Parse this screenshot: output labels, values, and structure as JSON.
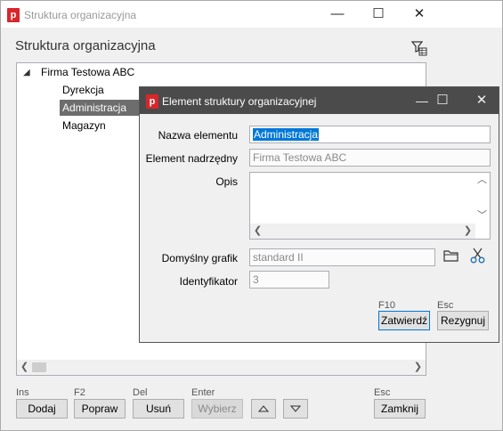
{
  "main_window": {
    "title": "Struktura organizacyjna",
    "app_icon_letter": "p",
    "controls": {
      "minimize": "—",
      "maximize": "☐",
      "close": "✕"
    },
    "heading": "Struktura organizacyjna",
    "tree": {
      "root": "Firma Testowa ABC",
      "children": [
        "Dyrekcja",
        "Administracja",
        "Magazyn"
      ],
      "selected_index": 1
    },
    "buttons": {
      "add": {
        "shortcut": "Ins",
        "label": "Dodaj"
      },
      "edit": {
        "shortcut": "F2",
        "label": "Popraw"
      },
      "delete": {
        "shortcut": "Del",
        "label": "Usuń"
      },
      "select": {
        "shortcut": "Enter",
        "label": "Wybierz"
      },
      "close": {
        "shortcut": "Esc",
        "label": "Zamknij"
      }
    }
  },
  "dialog": {
    "title": "Element struktury organizacyjnej",
    "app_icon_letter": "p",
    "controls": {
      "minimize": "—",
      "maximize": "☐",
      "close": "✕"
    },
    "fields": {
      "name": {
        "label": "Nazwa elementu",
        "value": "Administracja"
      },
      "parent": {
        "label": "Element nadrzędny",
        "value": "Firma Testowa ABC"
      },
      "description": {
        "label": "Opis",
        "value": ""
      },
      "schedule": {
        "label": "Domyślny grafik",
        "value": "standard II"
      },
      "identifier": {
        "label": "Identyfikator",
        "value": "3"
      }
    },
    "buttons": {
      "confirm": {
        "shortcut": "F10",
        "label": "Zatwierdź"
      },
      "cancel": {
        "shortcut": "Esc",
        "label": "Rezygnuj"
      }
    }
  },
  "colors": {
    "accent_red": "#d9262a",
    "selection_blue": "#0078d7",
    "dialog_titlebar": "#4b4b4b",
    "tree_selection": "#6d6d6d"
  }
}
